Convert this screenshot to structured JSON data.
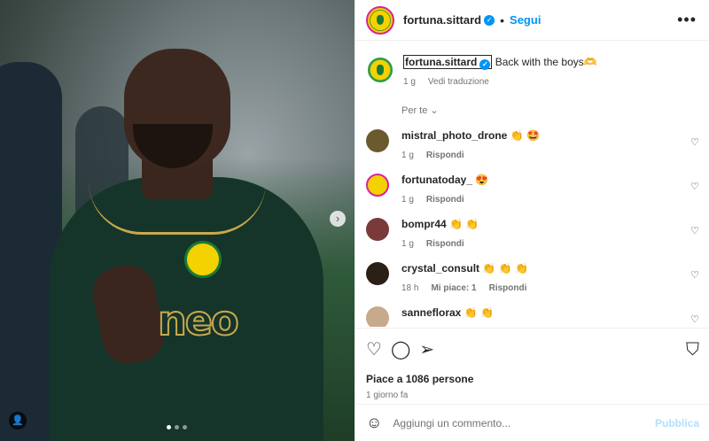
{
  "post": {
    "account": "fortuna.sittard",
    "follow_label": "Segui",
    "separator": "•",
    "more_label": "•••",
    "caption_text": "Back with the boys🫶",
    "caption_time": "1 g",
    "translate_label": "Vedi traduzione",
    "for_you_label": "Per te",
    "likes_text": "Piace a 1086 persone",
    "posted_ago": "1 giorno fa",
    "comment_placeholder": "Aggiungi un commento...",
    "publish_label": "Pubblica"
  },
  "carousel": {
    "dots": 3,
    "active": 0
  },
  "comments": [
    {
      "user": "mistral_photo_drone",
      "text": "👏 🤩",
      "time": "1 g",
      "reply": "Rispondi",
      "likes": ""
    },
    {
      "user": "fortunatoday_",
      "text": "😍",
      "time": "1 g",
      "reply": "Rispondi",
      "likes": ""
    },
    {
      "user": "bompr44",
      "text": "👏 👏",
      "time": "1 g",
      "reply": "Rispondi",
      "likes": ""
    },
    {
      "user": "crystal_consult",
      "text": "👏 👏 👏",
      "time": "18 h",
      "reply": "Rispondi",
      "likes": "Mi piace: 1"
    },
    {
      "user": "sanneflorax",
      "text": "👏 👏",
      "time": "",
      "reply": "",
      "likes": ""
    }
  ],
  "colors": {
    "link": "#0095f6",
    "muted": "#737373",
    "publish_disabled": "#b2dffc"
  }
}
